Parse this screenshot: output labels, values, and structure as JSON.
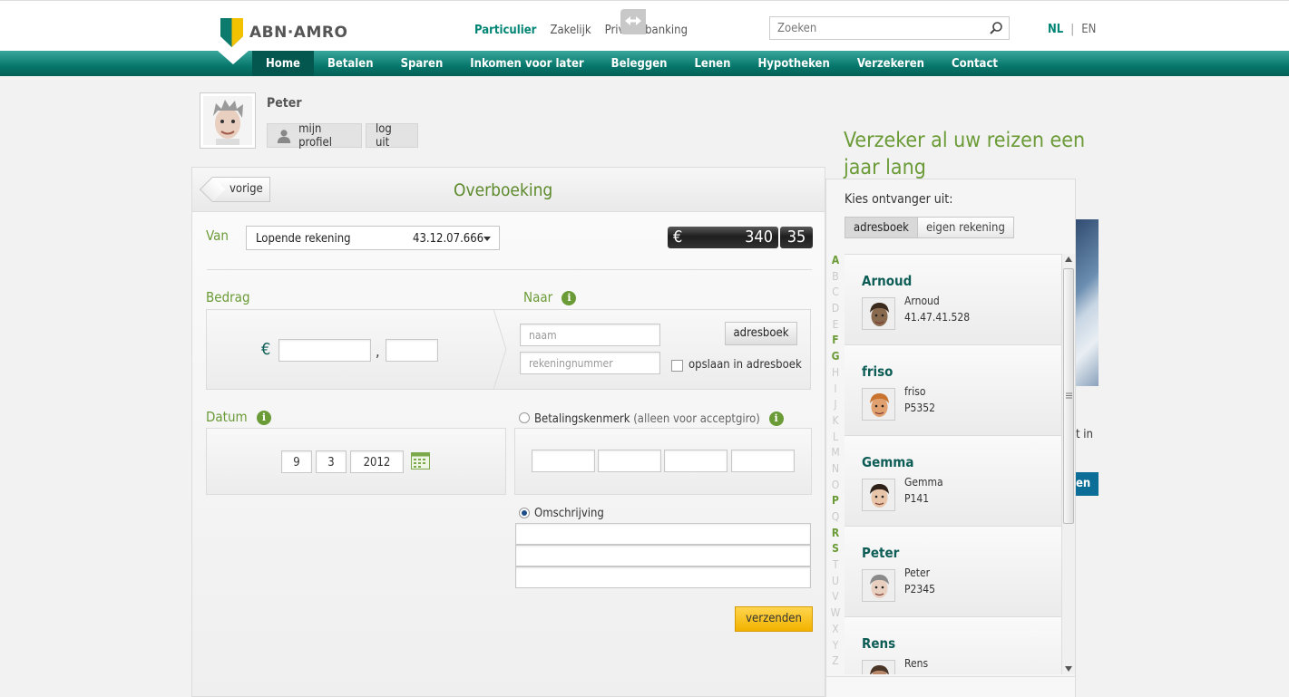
{
  "header": {
    "brand": "ABN·AMRO",
    "segments": [
      {
        "label": "Particulier",
        "active": true
      },
      {
        "label": "Zakelijk",
        "active": false
      },
      {
        "label": "Private banking",
        "active": false
      }
    ],
    "search_placeholder": "Zoeken",
    "lang_nl": "NL",
    "lang_sep": "|",
    "lang_en": "EN"
  },
  "nav": {
    "items": [
      {
        "label": "Home",
        "active": true
      },
      {
        "label": "Betalen"
      },
      {
        "label": "Sparen"
      },
      {
        "label": "Inkomen voor later"
      },
      {
        "label": "Beleggen"
      },
      {
        "label": "Lenen"
      },
      {
        "label": "Hypotheken"
      },
      {
        "label": "Verzekeren"
      },
      {
        "label": "Contact"
      }
    ]
  },
  "profile": {
    "name": "Peter",
    "my_profile": "mijn profiel",
    "logout": "log uit"
  },
  "promo": {
    "title": "Verzeker al uw reizen een jaar lang",
    "text_fragment": "t in",
    "button_fragment": "en"
  },
  "transfer": {
    "back": "vorige",
    "title": "Overboeking",
    "from_label": "Van",
    "account_name": "Lopende rekening",
    "account_number": "43.12.07.666",
    "balance_currency": "€",
    "balance_whole": "340",
    "balance_cents": "35",
    "amount_label": "Bedrag",
    "currency": "€",
    "decimal_sep": ",",
    "to_label": "Naar",
    "name_placeholder": "naam",
    "account_placeholder": "rekeningnummer",
    "addressbook_button": "adresboek",
    "save_addressbook": "opslaan in adresboek",
    "date_label": "Datum",
    "date_day": "9",
    "date_month": "3",
    "date_year": "2012",
    "payment_ref_label": "Betalingskenmerk",
    "payment_ref_note": "(alleen voor acceptgiro)",
    "description_label": "Omschrijving",
    "submit": "verzenden"
  },
  "addressbook": {
    "choose_label": "Kies ontvanger uit:",
    "tab_addressbook": "adresboek",
    "tab_own": "eigen rekening",
    "letters": [
      {
        "l": "A",
        "on": true
      },
      {
        "l": "B"
      },
      {
        "l": "C"
      },
      {
        "l": "D"
      },
      {
        "l": "E"
      },
      {
        "l": "F",
        "on": true
      },
      {
        "l": "G",
        "on": true
      },
      {
        "l": "H"
      },
      {
        "l": "I"
      },
      {
        "l": "J"
      },
      {
        "l": "K"
      },
      {
        "l": "L"
      },
      {
        "l": "M"
      },
      {
        "l": "N"
      },
      {
        "l": "O"
      },
      {
        "l": "P",
        "on": true
      },
      {
        "l": "Q"
      },
      {
        "l": "R",
        "on": true
      },
      {
        "l": "S",
        "on": true
      },
      {
        "l": "T"
      },
      {
        "l": "U"
      },
      {
        "l": "V"
      },
      {
        "l": "W"
      },
      {
        "l": "X"
      },
      {
        "l": "Y"
      },
      {
        "l": "Z"
      }
    ],
    "contacts": [
      {
        "name": "Arnoud",
        "line1": "Arnoud",
        "line2": "41.47.41.528",
        "skin": "#8a6a4f",
        "hair": "#3a2a1e"
      },
      {
        "name": "friso",
        "line1": "friso",
        "line2": "P5352",
        "skin": "#e0a070",
        "hair": "#c8732f"
      },
      {
        "name": "Gemma",
        "line1": "Gemma",
        "line2": "P141",
        "skin": "#e8c4a8",
        "hair": "#2d2018"
      },
      {
        "name": "Peter",
        "line1": "Peter",
        "line2": "P2345",
        "skin": "#e8cfc0",
        "hair": "#8a8a8a"
      },
      {
        "name": "Rens",
        "line1": "Rens",
        "line2": "",
        "skin": "#b9876a",
        "hair": "#4a3526"
      }
    ]
  }
}
